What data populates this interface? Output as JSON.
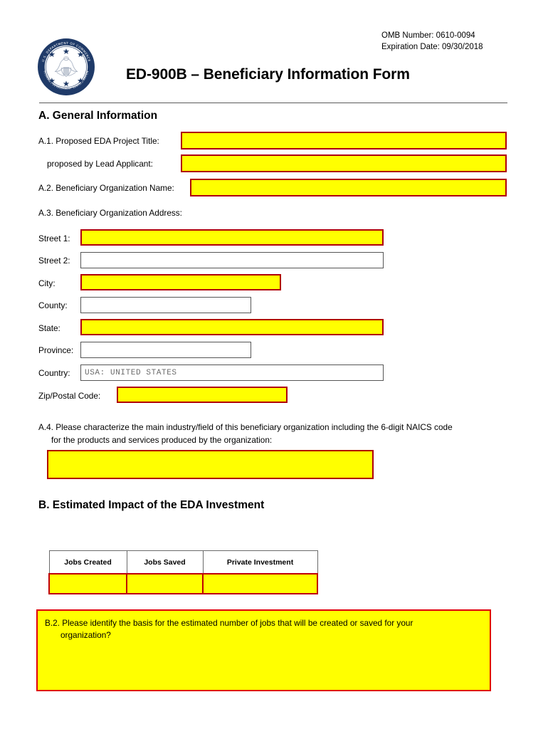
{
  "header": {
    "omb_number": "OMB Number: 0610-0094",
    "expiration_date": "Expiration Date: 09/30/2018",
    "title": "ED-900B – Beneficiary Information Form",
    "seal": {
      "name": "eda-doc-seal",
      "top_text": "U.S. DEPARTMENT OF COMMERCE",
      "bottom_text": "ECONOMIC DEVELOPMENT ADMINISTRATION",
      "color": "#1F3A68"
    }
  },
  "sections": {
    "a": {
      "heading": "A. General Information",
      "a1": {
        "label": "A.1. Proposed EDA Project Title:",
        "value": "",
        "sublabel": "proposed by Lead Applicant:",
        "subvalue": ""
      },
      "a2": {
        "label": "A.2. Beneficiary Organization Name:",
        "value": ""
      },
      "a3": {
        "label": "A.3. Beneficiary Organization Address:",
        "fields": [
          {
            "label": "Street 1:",
            "value": "",
            "required": true
          },
          {
            "label": "Street 2:",
            "value": "",
            "required": false
          },
          {
            "label": "City:",
            "value": "",
            "required": true
          },
          {
            "label": "County:",
            "value": "",
            "required": false
          },
          {
            "label": "State:",
            "value": "",
            "required": true
          },
          {
            "label": "Province:",
            "value": "",
            "required": false
          },
          {
            "label": "Country:",
            "value": "USA: UNITED STATES",
            "required": false
          },
          {
            "label": "Zip/Postal Code:",
            "value": "",
            "required": true
          }
        ]
      },
      "a4": {
        "line1": "A.4. Please characterize the main industry/field of this beneficiary organization including the 6-digit NAICS code",
        "line2": "for the products and services produced by the organization:",
        "value": ""
      }
    },
    "b": {
      "heading": "B. Estimated Impact of the EDA Investment",
      "table": {
        "columns": [
          "Jobs Created",
          "Jobs Saved",
          "Private Investment"
        ],
        "rows": [
          [
            "",
            "",
            ""
          ]
        ]
      },
      "b2": {
        "line1": "B.2. Please identify the basis for the estimated number of jobs that will be created or saved for your",
        "line2": "organization?",
        "value": ""
      }
    }
  },
  "colors": {
    "required_fill": "#FFFF00",
    "required_border": "#B00000",
    "optional_border": "#555555",
    "seal_navy": "#1F3A68"
  }
}
